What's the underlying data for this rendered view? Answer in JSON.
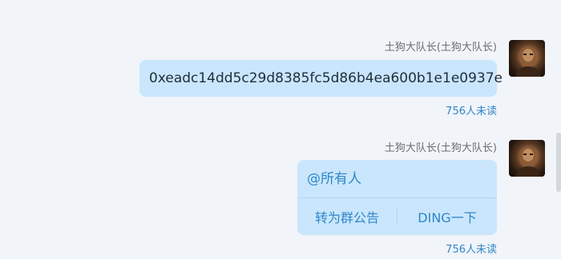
{
  "messages": [
    {
      "sender": "土狗大队长(土狗大队长)",
      "text": "0xeadc14dd5c29d8385fc5d86b4ea600b1e1e0937e",
      "read_status": "756人未读"
    },
    {
      "sender": "土狗大队长(土狗大队长)",
      "text": "@所有人",
      "actions": {
        "announce": "转为群公告",
        "ding": "DING一下"
      },
      "read_status": "756人未读"
    }
  ],
  "colors": {
    "background": "#f1f4f9",
    "bubble": "#c9e6fc",
    "link": "#2f86c9"
  }
}
